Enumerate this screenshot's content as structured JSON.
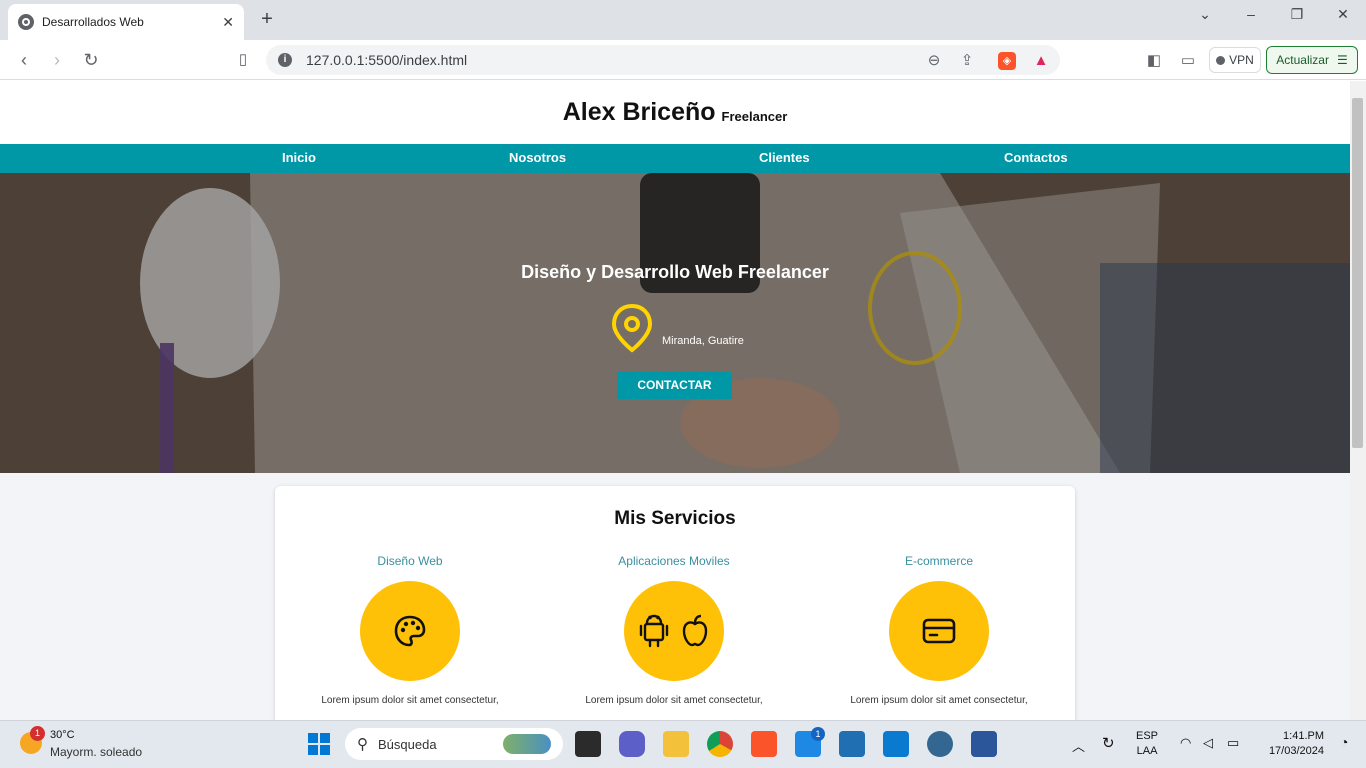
{
  "browser": {
    "tab_title": "Desarrollados Web",
    "tab_close": "✕",
    "new_tab": "+",
    "url": "127.0.0.1:5500/index.html",
    "vpn_label": "VPN",
    "update_label": "Actualizar"
  },
  "site": {
    "name": "Alex Briceño",
    "role": "Freelancer",
    "nav": [
      "Inicio",
      "Nosotros",
      "Clientes",
      "Contactos"
    ],
    "hero_title": "Diseño y Desarrollo Web Freelancer",
    "location": "Miranda, Guatire",
    "cta_label": "CONTACTAR",
    "accent_color": "#0097a7",
    "services_title": "Mis Servicios",
    "services": [
      {
        "name": "Diseño Web",
        "icon": "palette-icon",
        "text": "Lorem ipsum dolor sit amet consectetur,"
      },
      {
        "name": "Aplicaciones Moviles",
        "icon": "android-apple-icon",
        "text": "Lorem ipsum dolor sit amet consectetur,"
      },
      {
        "name": "E-commerce",
        "icon": "credit-card-icon",
        "text": "Lorem ipsum dolor sit amet consectetur,"
      }
    ],
    "service_color": "#ffc107"
  },
  "taskbar": {
    "weather_temp": "30°C",
    "weather_desc": "Mayorm. soleado",
    "weather_badge": "1",
    "search_placeholder": "Búsqueda",
    "lang_1": "ESP",
    "lang_2": "LAA",
    "time": "1:41.PM",
    "date": "17/03/2024",
    "app_badge": "1"
  }
}
